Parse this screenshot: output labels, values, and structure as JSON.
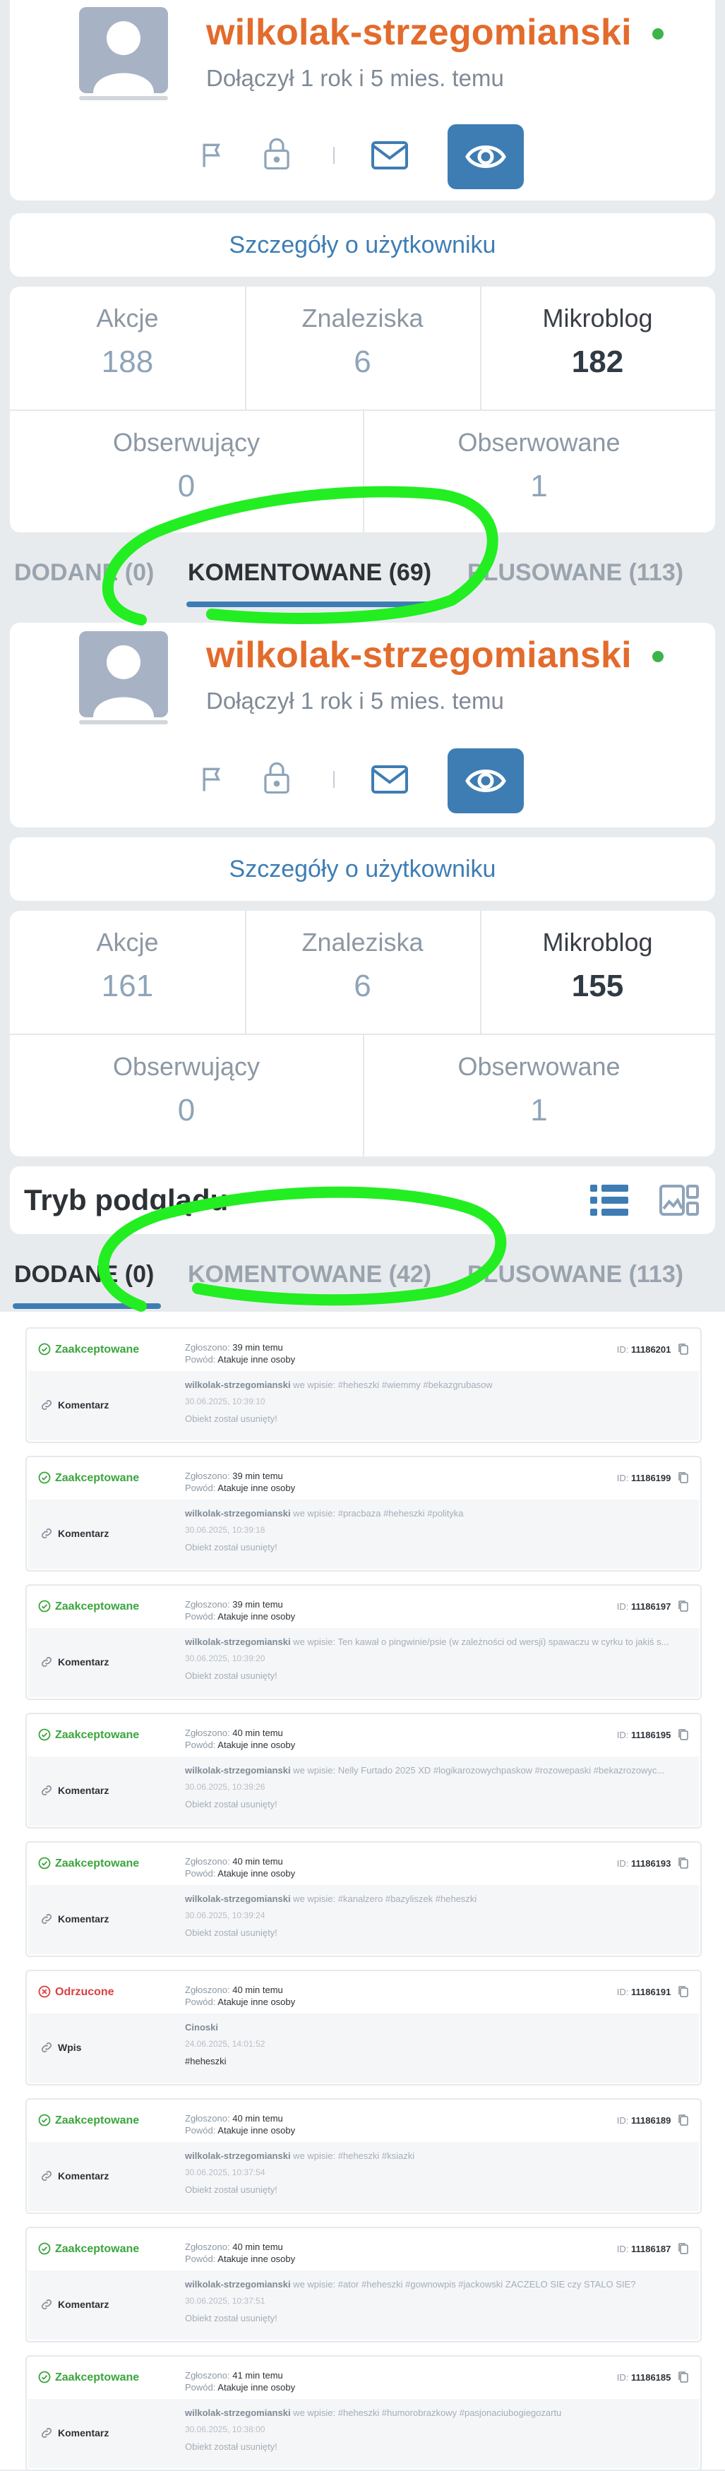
{
  "profile_top": {
    "username": "wilkolak-strzegomianski",
    "joined": "Dołączył 1 rok i 5 mies. temu",
    "details_label": "Szczegóły o użytkowniku",
    "stats": {
      "actions_label": "Akcje",
      "actions": "188",
      "finds_label": "Znaleziska",
      "finds": "6",
      "microblog_label": "Mikroblog",
      "microblog": "182",
      "followers_label": "Obserwujący",
      "followers": "0",
      "following_label": "Obserwowane",
      "following": "1"
    },
    "tabs": [
      "DODANE (0)",
      "KOMENTOWANE (69)",
      "PLUSOWANE (113)"
    ]
  },
  "profile_bottom": {
    "username": "wilkolak-strzegomianski",
    "joined": "Dołączył 1 rok i 5 mies. temu",
    "details_label": "Szczegóły o użytkowniku",
    "stats": {
      "actions_label": "Akcje",
      "actions": "161",
      "finds_label": "Znaleziska",
      "finds": "6",
      "microblog_label": "Mikroblog",
      "microblog": "155",
      "followers_label": "Obserwujący",
      "followers": "0",
      "following_label": "Obserwowane",
      "following": "1"
    },
    "view_mode_label": "Tryb podglądu",
    "tabs": [
      "DODANE (0)",
      "KOMENTOWANE (42)",
      "PLUSOWANE (113)"
    ]
  },
  "colors": {
    "accent": "#3e7db4",
    "username": "#e36b2c",
    "online": "#3bb54a",
    "highlight": "#22ee22",
    "accepted": "#3ba53d",
    "rejected": "#d94040"
  },
  "labels": {
    "reported": "Zgłoszono:",
    "reason": "Powód:",
    "id": "ID:"
  },
  "reports": [
    {
      "status": "Zaakceptowane",
      "time": "39 min temu",
      "reason": "Atakuje inne osoby",
      "id": "11186201",
      "type": "Komentarz",
      "author": "wilkolak-strzegomianski",
      "context": " we wpisie: #heheszki #wiemmy #bekazgrubasow",
      "date": "30.06.2025, 10:39:10",
      "note": "Obiekt został usunięty!"
    },
    {
      "status": "Zaakceptowane",
      "time": "39 min temu",
      "reason": "Atakuje inne osoby",
      "id": "11186199",
      "type": "Komentarz",
      "author": "wilkolak-strzegomianski",
      "context": " we wpisie: #pracbaza #heheszki #polityka",
      "date": "30.06.2025, 10:39:18",
      "note": "Obiekt został usunięty!"
    },
    {
      "status": "Zaakceptowane",
      "time": "39 min temu",
      "reason": "Atakuje inne osoby",
      "id": "11186197",
      "type": "Komentarz",
      "author": "wilkolak-strzegomianski",
      "context": " we wpisie: Ten kawał o pingwinie/psie (w zależności od wersji) spawaczu w cyrku to jakiś s...",
      "date": "30.06.2025, 10:39:20",
      "note": "Obiekt został usunięty!"
    },
    {
      "status": "Zaakceptowane",
      "time": "40 min temu",
      "reason": "Atakuje inne osoby",
      "id": "11186195",
      "type": "Komentarz",
      "author": "wilkolak-strzegomianski",
      "context": " we wpisie: Nelly Furtado 2025 XD #logikarozowychpaskow #rozowepaski #bekazrozowyc...",
      "date": "30.06.2025, 10:39:26",
      "note": "Obiekt został usunięty!"
    },
    {
      "status": "Zaakceptowane",
      "time": "40 min temu",
      "reason": "Atakuje inne osoby",
      "id": "11186193",
      "type": "Komentarz",
      "author": "wilkolak-strzegomianski",
      "context": " we wpisie: #kanalzero #bazyliszek #heheszki",
      "date": "30.06.2025, 10:39:24",
      "note": "Obiekt został usunięty!"
    },
    {
      "status": "Odrzucone",
      "time": "40 min temu",
      "reason": "Atakuje inne osoby",
      "id": "11186191",
      "type": "Wpis",
      "author": "Cinoski",
      "context": "",
      "date": "24.06.2025, 14:01:52",
      "note": "#heheszki"
    },
    {
      "status": "Zaakceptowane",
      "time": "40 min temu",
      "reason": "Atakuje inne osoby",
      "id": "11186189",
      "type": "Komentarz",
      "author": "wilkolak-strzegomianski",
      "context": " we wpisie: #heheszki #ksiazki",
      "date": "30.06.2025, 10:37:54",
      "note": "Obiekt został usunięty!"
    },
    {
      "status": "Zaakceptowane",
      "time": "40 min temu",
      "reason": "Atakuje inne osoby",
      "id": "11186187",
      "type": "Komentarz",
      "author": "wilkolak-strzegomianski",
      "context": " we wpisie: #ator #heheszki #gownowpis #jackowski ZACZELO SIE czy STALO SIE?",
      "date": "30.06.2025, 10:37:51",
      "note": "Obiekt został usunięty!"
    },
    {
      "status": "Zaakceptowane",
      "time": "41 min temu",
      "reason": "Atakuje inne osoby",
      "id": "11186185",
      "type": "Komentarz",
      "author": "wilkolak-strzegomianski",
      "context": " we wpisie: #heheszki #humorobrazkowy #pasjonaciubogiegozartu",
      "date": "30.06.2025, 10:38:00",
      "note": "Obiekt został usunięty!"
    }
  ]
}
